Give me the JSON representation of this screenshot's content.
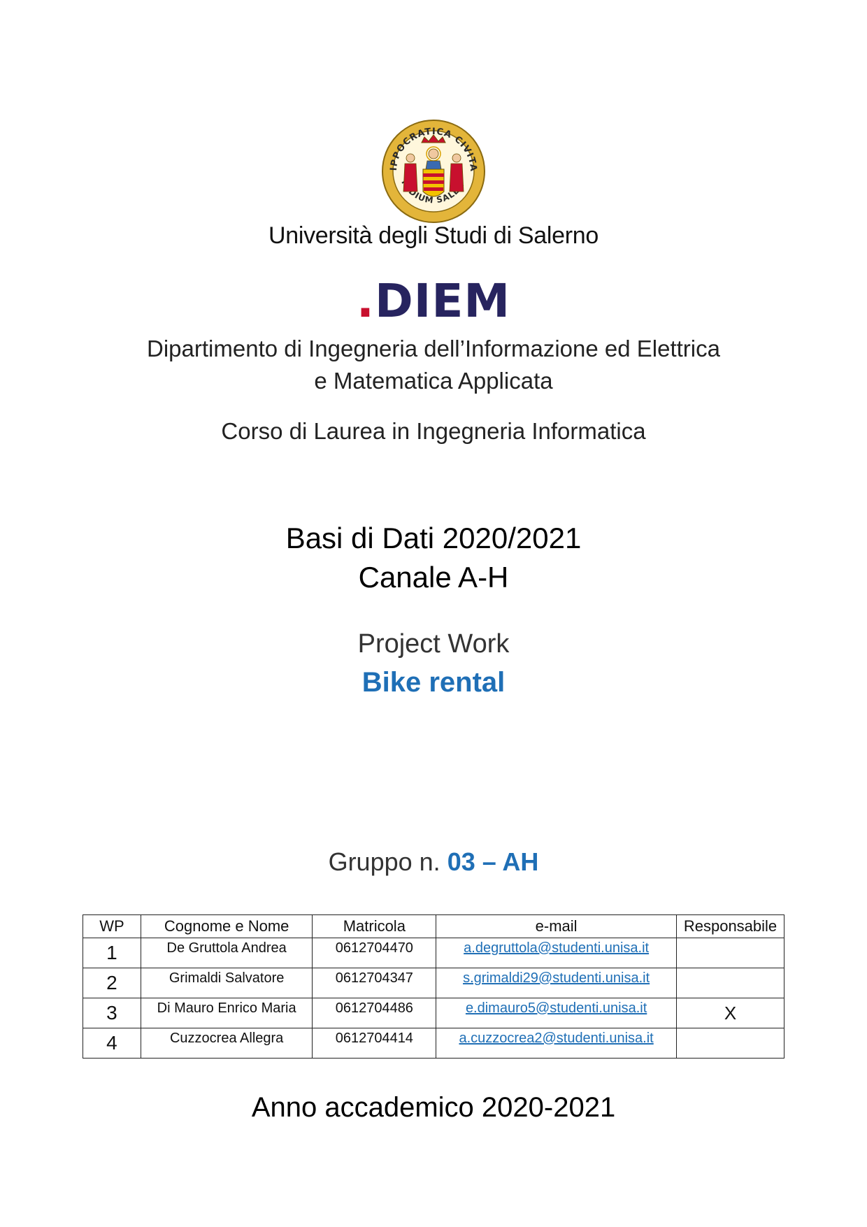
{
  "header": {
    "university": "Università degli Studi di Salerno",
    "seal_motto_top": "HIPPOCRATICA CIVITAS",
    "seal_motto_bottom": "STUDIUM SALERNI",
    "logo_text": "DIEM",
    "logo_dot": ".",
    "department": "Dipartimento di Ingegneria dell’Informazione ed Elettrica e Matematica Applicata",
    "course": "Corso di Laurea in Ingegneria Informatica"
  },
  "subject": {
    "title": "Basi di Dati 2020/2021",
    "channel": "Canale A-H"
  },
  "project": {
    "label": "Project Work",
    "title": "Bike rental"
  },
  "group": {
    "prefix": "Gruppo n.",
    "number": "03 – AH"
  },
  "table": {
    "headers": [
      "WP",
      "Cognome e Nome",
      "Matricola",
      "e-mail",
      "Responsabile"
    ],
    "rows": [
      {
        "wp": "1",
        "name": "De Gruttola Andrea",
        "id": "0612704470",
        "email": "a.degruttola@studenti.unisa.it",
        "resp": ""
      },
      {
        "wp": "2",
        "name": "Grimaldi Salvatore",
        "id": "0612704347",
        "email": "s.grimaldi29@studenti.unisa.it",
        "resp": ""
      },
      {
        "wp": "3",
        "name": "Di Mauro Enrico Maria",
        "id": "0612704486",
        "email": "e.dimauro5@studenti.unisa.it",
        "resp": "X"
      },
      {
        "wp": "4",
        "name": "Cuzzocrea Allegra",
        "id": "0612704414",
        "email": "a.cuzzocrea2@studenti.unisa.it",
        "resp": ""
      }
    ]
  },
  "footer": {
    "academic_year": "Anno accademico 2020-2021"
  },
  "colors": {
    "accent_blue": "#1f6fb6",
    "logo_navy": "#27245f",
    "logo_red": "#c8102e",
    "seal_gold": "#e3b53a"
  }
}
